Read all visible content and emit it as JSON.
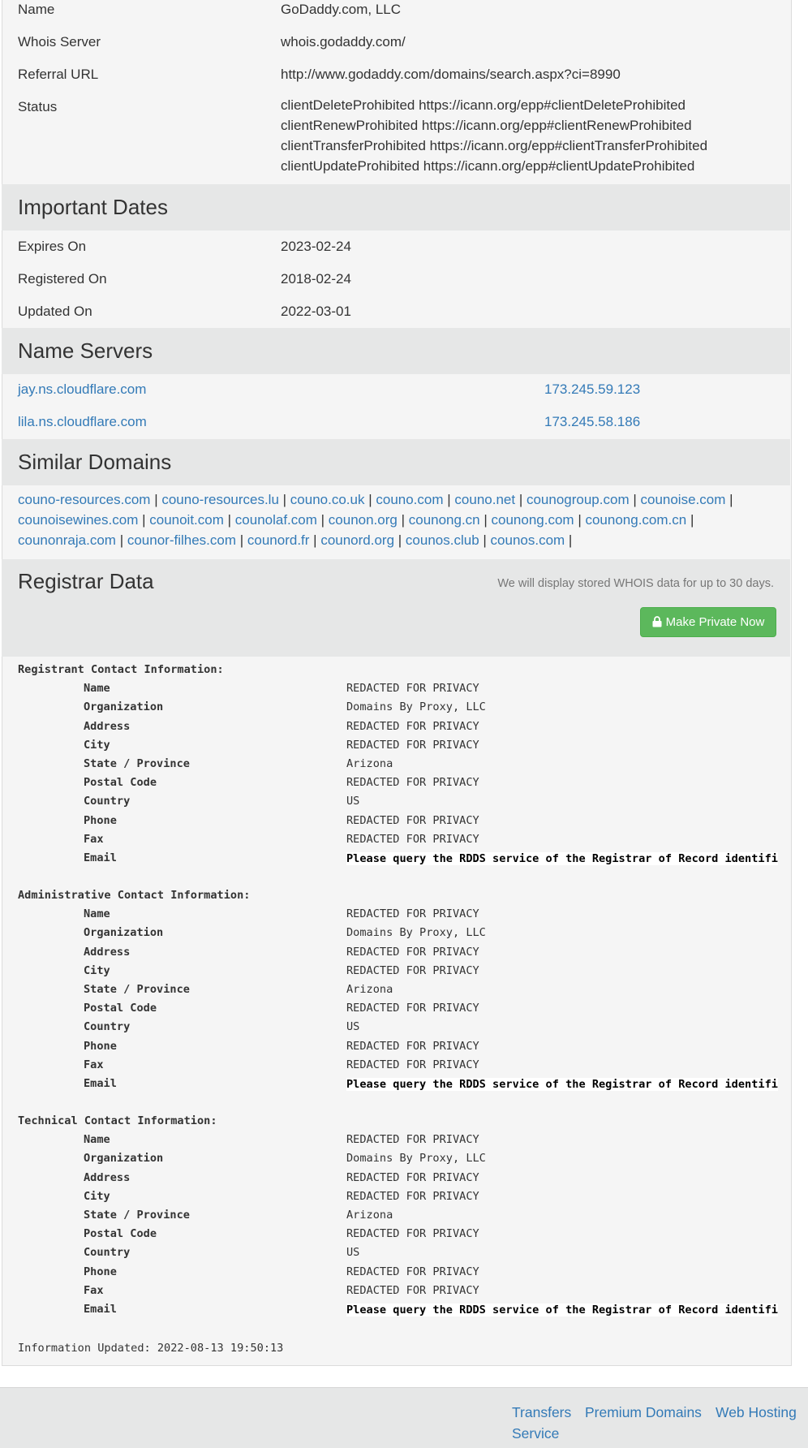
{
  "registrar_info": {
    "name_label": "Name",
    "name_value": "GoDaddy.com, LLC",
    "whois_label": "Whois Server",
    "whois_value": "whois.godaddy.com/",
    "referral_label": "Referral URL",
    "referral_value": "http://www.godaddy.com/domains/search.aspx?ci=8990",
    "status_label": "Status",
    "status_lines": [
      "clientDeleteProhibited https://icann.org/epp#clientDeleteProhibited",
      "clientRenewProhibited https://icann.org/epp#clientRenewProhibited",
      "clientTransferProhibited https://icann.org/epp#clientTransferProhibited",
      "clientUpdateProhibited https://icann.org/epp#clientUpdateProhibited"
    ]
  },
  "important_dates": {
    "title": "Important Dates",
    "expires_label": "Expires On",
    "expires_value": "2023-02-24",
    "registered_label": "Registered On",
    "registered_value": "2018-02-24",
    "updated_label": "Updated On",
    "updated_value": "2022-03-01"
  },
  "name_servers": {
    "title": "Name Servers",
    "items": [
      {
        "host": "jay.ns.cloudflare.com",
        "ip": "173.245.59.123"
      },
      {
        "host": "lila.ns.cloudflare.com",
        "ip": "173.245.58.186"
      }
    ]
  },
  "similar_domains": {
    "title": "Similar Domains",
    "separator": " | ",
    "items": [
      "couno-resources.com",
      "couno-resources.lu",
      "couno.co.uk",
      "couno.com",
      "couno.net",
      "counogroup.com",
      "counoise.com",
      "counoisewines.com",
      "counoit.com",
      "counolaf.com",
      "counon.org",
      "counong.cn",
      "counong.com",
      "counong.com.cn",
      "counonraja.com",
      "counor-filhes.com",
      "counord.fr",
      "counord.org",
      "counos.club",
      "counos.com"
    ]
  },
  "registrar_data": {
    "title": "Registrar Data",
    "notice": "We will display stored WHOIS data for up to 30 days.",
    "make_private_label": "Make Private Now",
    "contacts": [
      {
        "header": "Registrant Contact Information:",
        "fields": [
          {
            "key": "Name",
            "value": "REDACTED FOR PRIVACY"
          },
          {
            "key": "Organization",
            "value": "Domains By Proxy, LLC"
          },
          {
            "key": "Address",
            "value": "REDACTED FOR PRIVACY"
          },
          {
            "key": "City",
            "value": "REDACTED FOR PRIVACY"
          },
          {
            "key": "State / Province",
            "value": "Arizona"
          },
          {
            "key": "Postal Code",
            "value": "REDACTED FOR PRIVACY"
          },
          {
            "key": "Country",
            "value": "US"
          },
          {
            "key": "Phone",
            "value": "REDACTED FOR PRIVACY"
          },
          {
            "key": "Fax",
            "value": "REDACTED FOR PRIVACY"
          },
          {
            "key": "Email",
            "value": "Please query the RDDS service of the Registrar of Record identifi",
            "email": true
          }
        ]
      },
      {
        "header": "Administrative Contact Information:",
        "fields": [
          {
            "key": "Name",
            "value": "REDACTED FOR PRIVACY"
          },
          {
            "key": "Organization",
            "value": "Domains By Proxy, LLC"
          },
          {
            "key": "Address",
            "value": "REDACTED FOR PRIVACY"
          },
          {
            "key": "City",
            "value": "REDACTED FOR PRIVACY"
          },
          {
            "key": "State / Province",
            "value": "Arizona"
          },
          {
            "key": "Postal Code",
            "value": "REDACTED FOR PRIVACY"
          },
          {
            "key": "Country",
            "value": "US"
          },
          {
            "key": "Phone",
            "value": "REDACTED FOR PRIVACY"
          },
          {
            "key": "Fax",
            "value": "REDACTED FOR PRIVACY"
          },
          {
            "key": "Email",
            "value": "Please query the RDDS service of the Registrar of Record identifi",
            "email": true
          }
        ]
      },
      {
        "header": "Technical Contact Information:",
        "fields": [
          {
            "key": "Name",
            "value": "REDACTED FOR PRIVACY"
          },
          {
            "key": "Organization",
            "value": "Domains By Proxy, LLC"
          },
          {
            "key": "Address",
            "value": "REDACTED FOR PRIVACY"
          },
          {
            "key": "City",
            "value": "REDACTED FOR PRIVACY"
          },
          {
            "key": "State / Province",
            "value": "Arizona"
          },
          {
            "key": "Postal Code",
            "value": "REDACTED FOR PRIVACY"
          },
          {
            "key": "Country",
            "value": "US"
          },
          {
            "key": "Phone",
            "value": "REDACTED FOR PRIVACY"
          },
          {
            "key": "Fax",
            "value": "REDACTED FOR PRIVACY"
          },
          {
            "key": "Email",
            "value": "Please query the RDDS service of the Registrar of Record identifi",
            "email": true
          }
        ]
      }
    ],
    "updated_text": "Information Updated: 2022-08-13 19:50:13"
  },
  "footer": {
    "links": [
      "Transfers",
      "Premium Domains",
      "Web Hosting"
    ],
    "cut_link": "Service"
  },
  "colors": {
    "link": "#337ab7",
    "section_bg": "#e6e7e7",
    "panel_bg": "#f5f5f5",
    "button_green": "#5cb85c"
  }
}
